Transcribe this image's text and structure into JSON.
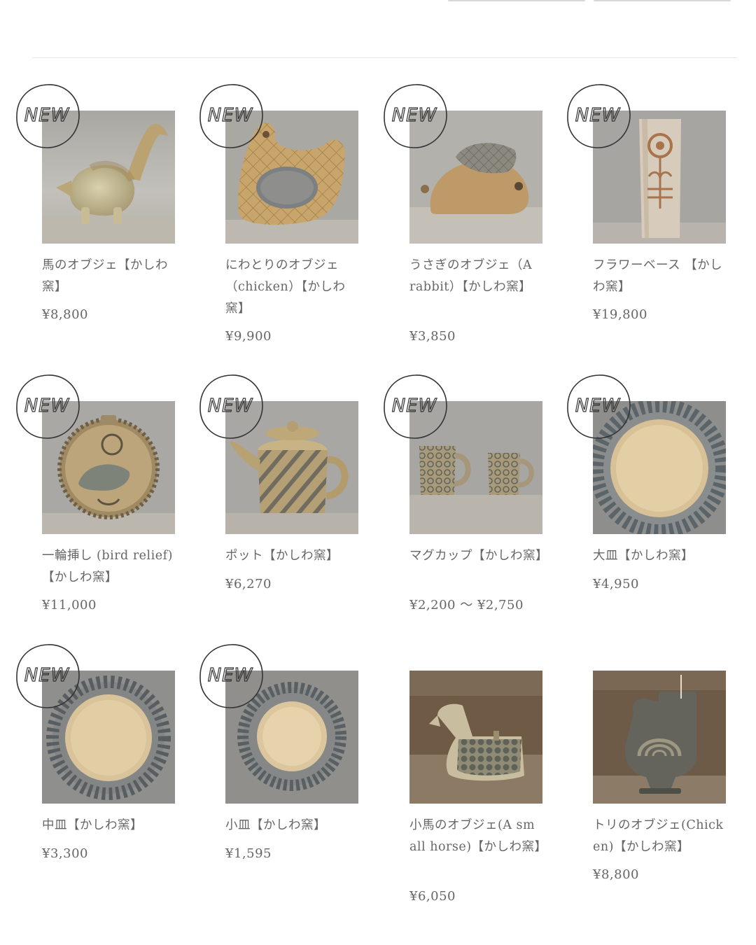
{
  "badge": {
    "label": "NEW"
  },
  "products": [
    {
      "title": "馬のオブジェ【かしわ窯】",
      "price": "¥8,800",
      "is_new": true,
      "icon": "horse-object-photo"
    },
    {
      "title": "にわとりのオブジェ（chicken）【かしわ窯】",
      "price": "¥9,900",
      "is_new": true,
      "icon": "chicken-object-photo"
    },
    {
      "title": "うさぎのオブジェ（A rabbit）【かしわ窯】",
      "price": "¥3,850",
      "is_new": true,
      "icon": "rabbit-object-photo"
    },
    {
      "title": "フラワーベース 【かしわ窯】",
      "price": "¥19,800",
      "is_new": true,
      "icon": "flower-vase-photo"
    },
    {
      "title": "一輪挿し (bird relief)【かしわ窯】",
      "price": "¥11,000",
      "is_new": true,
      "icon": "bud-vase-photo"
    },
    {
      "title": "ポット【かしわ窯】",
      "price": "¥6,270",
      "is_new": true,
      "icon": "teapot-photo"
    },
    {
      "title": "マグカップ【かしわ窯】",
      "price": "¥2,200 〜 ¥2,750",
      "is_new": true,
      "icon": "mug-cups-photo"
    },
    {
      "title": "大皿【かしわ窯】",
      "price": "¥4,950",
      "is_new": true,
      "icon": "large-plate-photo"
    },
    {
      "title": "中皿【かしわ窯】",
      "price": "¥3,300",
      "is_new": true,
      "icon": "medium-plate-photo"
    },
    {
      "title": "小皿【かしわ窯】",
      "price": "¥1,595",
      "is_new": true,
      "icon": "small-plate-photo"
    },
    {
      "title": "小馬のオブジェ(A small horse)【かしわ窯】",
      "price": "¥6,050",
      "is_new": false,
      "icon": "small-horse-photo"
    },
    {
      "title": "トリのオブジェ(Chicken)【かしわ窯】",
      "price": "¥8,800",
      "is_new": false,
      "icon": "bird-object-photo"
    }
  ]
}
